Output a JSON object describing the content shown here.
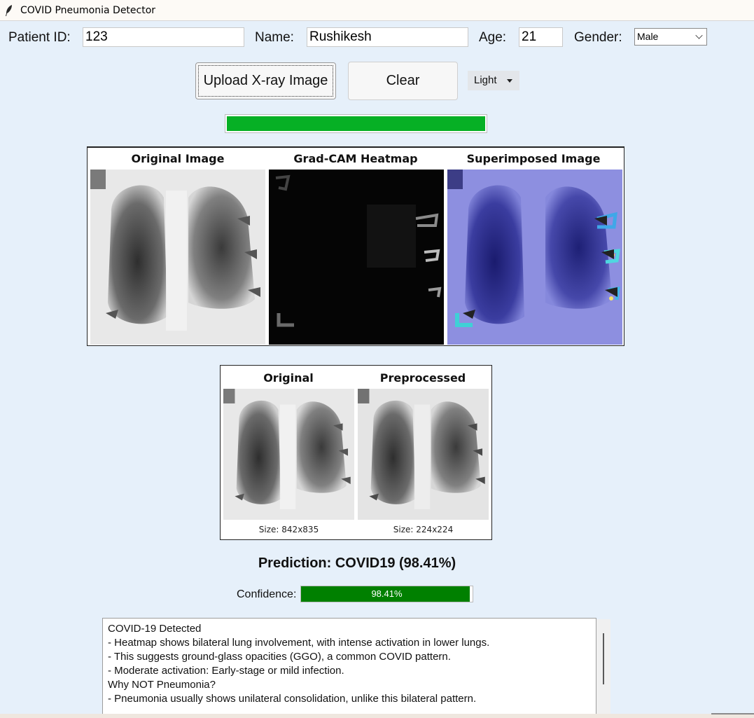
{
  "window": {
    "title": "COVID Pneumonia Detector"
  },
  "form": {
    "patient_id_label": "Patient ID:",
    "patient_id_value": "123",
    "name_label": "Name:",
    "name_value": "Rushikesh",
    "age_label": "Age:",
    "age_value": "21",
    "gender_label": "Gender:",
    "gender_value": "Male"
  },
  "toolbar": {
    "upload_label": "Upload X-ray Image",
    "clear_label": "Clear",
    "theme_value": "Light"
  },
  "upload_progress": {
    "percent": 100,
    "color": "#06b025"
  },
  "analysis_figure": {
    "panels": [
      {
        "title": "Original Image",
        "image": "chest x-ray (grayscale)"
      },
      {
        "title": "Grad-CAM Heatmap",
        "image": "grad-cam heatmap"
      },
      {
        "title": "Superimposed Image",
        "image": "x-ray with heatmap overlay"
      }
    ]
  },
  "preprocess_figure": {
    "panels": [
      {
        "title": "Original",
        "size": "Size: 842x835"
      },
      {
        "title": "Preprocessed",
        "size": "Size: 224x224"
      }
    ]
  },
  "result": {
    "prediction": "Prediction: COVID19 (98.41%)",
    "confidence_label": "Confidence:",
    "confidence_value": 98.41,
    "confidence_text": "98.41%",
    "confidence_color": "#008000"
  },
  "explanation": {
    "lines": [
      "COVID-19 Detected",
      "- Heatmap shows bilateral lung involvement, with intense activation in lower lungs.",
      "- This suggests ground-glass opacities (GGO), a common COVID pattern.",
      "- Moderate activation: Early-stage or mild infection.",
      "",
      "Why NOT Pneumonia?",
      "- Pneumonia usually shows unilateral consolidation, unlike this bilateral pattern."
    ]
  }
}
